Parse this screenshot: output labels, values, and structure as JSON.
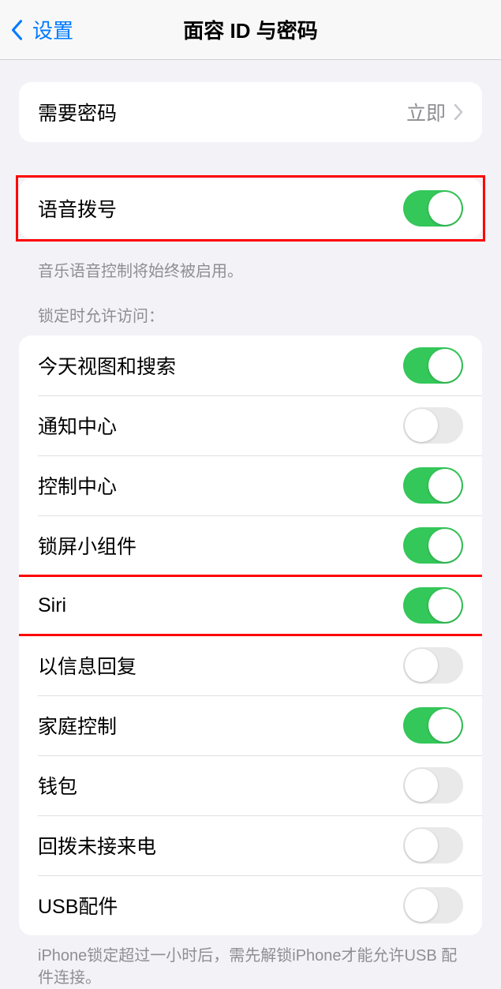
{
  "nav": {
    "back_label": "设置",
    "title": "面容 ID 与密码"
  },
  "passcode": {
    "label": "需要密码",
    "value": "立即"
  },
  "voice_dial": {
    "label": "语音拨号",
    "on": true,
    "footer": "音乐语音控制将始终被启用。"
  },
  "lock_access": {
    "header": "锁定时允许访问：",
    "items": [
      {
        "label": "今天视图和搜索",
        "on": true
      },
      {
        "label": "通知中心",
        "on": false
      },
      {
        "label": "控制中心",
        "on": true
      },
      {
        "label": "锁屏小组件",
        "on": true
      },
      {
        "label": "Siri",
        "on": true
      },
      {
        "label": "以信息回复",
        "on": false
      },
      {
        "label": "家庭控制",
        "on": true
      },
      {
        "label": "钱包",
        "on": false
      },
      {
        "label": "回拨未接来电",
        "on": false
      },
      {
        "label": "USB配件",
        "on": false
      }
    ],
    "footer": "iPhone锁定超过一小时后，需先解锁iPhone才能允许USB 配件连接。"
  }
}
